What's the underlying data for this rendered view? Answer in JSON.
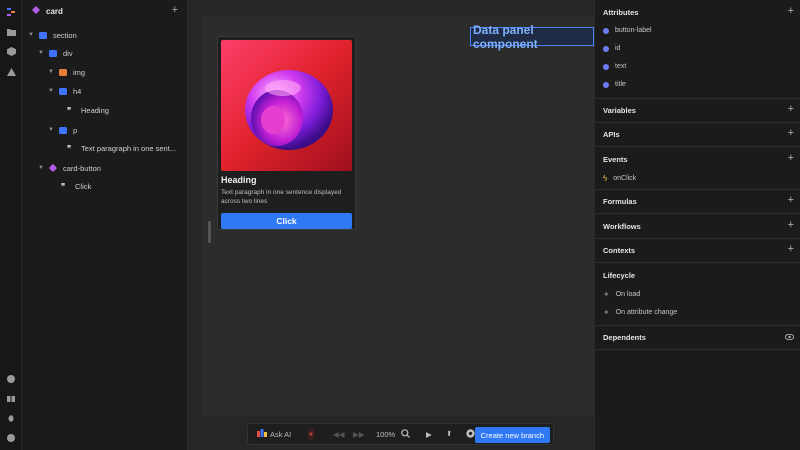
{
  "layers": {
    "title": "card",
    "add": "+",
    "nodes": [
      {
        "label": "section"
      },
      {
        "label": "div"
      },
      {
        "label": "img"
      },
      {
        "label": "h4"
      },
      {
        "label": "Heading"
      },
      {
        "label": "p"
      },
      {
        "label": "Text paragraph in one sent..."
      },
      {
        "label": "card-button"
      },
      {
        "label": "Click"
      }
    ],
    "fx": "fx"
  },
  "canvas": {
    "component_label": "Data panel component",
    "card": {
      "heading": "Heading",
      "paragraph": "Text paragraph in one sentence displayed across two lines",
      "button": "Click"
    }
  },
  "toolbar": {
    "ask_ai": "Ask AI",
    "zoom": "100%",
    "create_branch": "Create new branch"
  },
  "props": {
    "attributes_title": "Attributes",
    "attributes": [
      "button-label",
      "id",
      "text",
      "title"
    ],
    "variables": "Variables",
    "apis": "APIs",
    "events": "Events",
    "event_items": [
      "onClick"
    ],
    "formulas": "Formulas",
    "workflows": "Workflows",
    "contexts": "Contexts",
    "lifecycle": "Lifecycle",
    "lifecycle_items": [
      "On load",
      "On attribute change"
    ],
    "dependents": "Dependents",
    "plus": "+"
  },
  "colors": {
    "accent": "#2f78f6",
    "component_outline": "#4a84ff",
    "attribute_dot": "#6b7cf0",
    "event_bolt": "#f3c23a",
    "layer_blue": "#3f73ff",
    "layer_orange": "#e87f36",
    "layer_purple": "#b35ee8"
  },
  "icons": {
    "rail": [
      "logo-icon",
      "folder-icon",
      "package-icon",
      "warning-icon",
      "palette-icon",
      "gift-icon",
      "bug-icon",
      "help-icon"
    ]
  }
}
